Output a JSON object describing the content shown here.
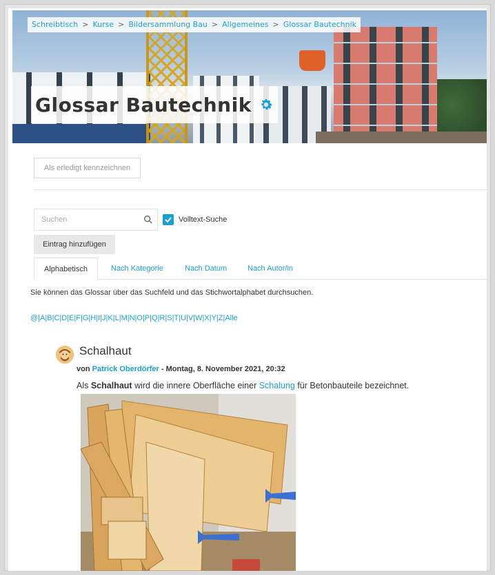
{
  "breadcrumb": {
    "items": [
      "Schreibtisch",
      "Kurse",
      "Bildersammlung Bau",
      "Allgemeines",
      "Glossar Bautechnik"
    ],
    "separator": ">"
  },
  "page": {
    "title": "Glossar Bautechnik"
  },
  "actions": {
    "mark_complete": "Als erledigt kennzeichnen",
    "add_entry": "Eintrag hinzufügen"
  },
  "search": {
    "placeholder": "Suchen",
    "fulltext_label": "Volltext-Suche",
    "fulltext_checked": true
  },
  "tabs": [
    {
      "label": "Alphabetisch",
      "active": true
    },
    {
      "label": "Nach Kategorie",
      "active": false
    },
    {
      "label": "Nach Datum",
      "active": false
    },
    {
      "label": "Nach Autor/in",
      "active": false
    }
  ],
  "description": "Sie können das Glossar über das Suchfeld und das Stichwortalphabet durchsuchen.",
  "alphabet": [
    "@",
    "A",
    "B",
    "C",
    "D",
    "E",
    "F",
    "G",
    "H",
    "I",
    "J",
    "K",
    "L",
    "M",
    "N",
    "O",
    "P",
    "Q",
    "R",
    "S",
    "T",
    "U",
    "V",
    "W",
    "X",
    "Y",
    "Z",
    "Alle"
  ],
  "entry": {
    "title": "Schalhaut",
    "by": "von",
    "author": "Patrick Oberdörfer",
    "date": "- Montag, 8. November 2021, 20:32",
    "text_before": "Als ",
    "term": "Schalhaut",
    "text_middle": " wird die innere Oberfläche einer ",
    "link": "Schalung",
    "text_after": " für Betonbauteile bezeichnet."
  },
  "colors": {
    "accent": "#1a9fd1",
    "text": "#333333",
    "arrow": "#3b6fd1"
  },
  "icons": {
    "settings": "gear-icon",
    "search": "search-icon",
    "checkbox": "check-icon"
  }
}
